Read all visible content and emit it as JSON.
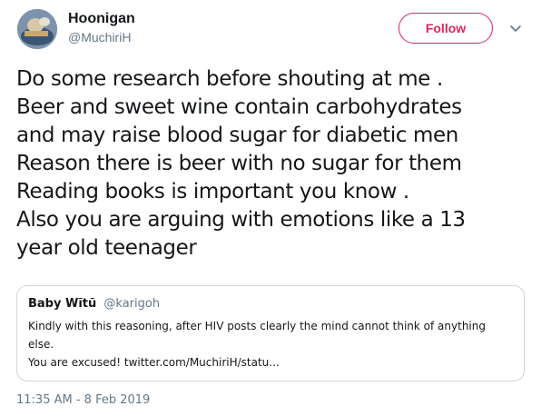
{
  "user": {
    "display_name": "Hoonigan",
    "handle": "@MuchiriH",
    "avatar_icon": "profile-avatar"
  },
  "follow_button": {
    "label": "Follow",
    "color": "#e0245e"
  },
  "menu_icon": "chevron-down-icon",
  "tweet": {
    "lines": [
      "Do some research before shouting at me .",
      "Beer and sweet wine contain carbohydrates",
      "and may raise blood sugar for diabetic men",
      "Reason there is beer with no sugar for them",
      "Reading books is important you know .",
      "Also you are arguing with emotions like a 13",
      "year old teenager"
    ]
  },
  "quoted_tweet": {
    "name": "Baby Wĩtũ",
    "handle": "@karigoh",
    "lines": [
      "Kindly with this  reasoning, after HIV posts clearly the mind cannot think of anything",
      "else.",
      "You are excused! twitter.com/MuchiriH/statu..."
    ]
  },
  "timestamp": "11:35 AM - 8 Feb 2019",
  "colors": {
    "text_primary": "#14171a",
    "text_secondary": "#657786",
    "border": "#ccd6dd"
  }
}
